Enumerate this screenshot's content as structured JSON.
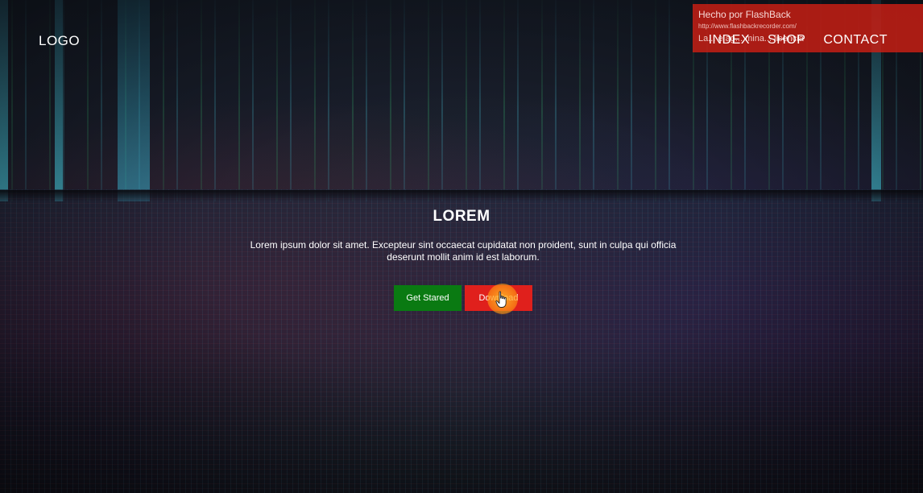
{
  "navbar": {
    "logo": "LOGO",
    "links": [
      {
        "label": "INDEX"
      },
      {
        "label": "SHOP"
      },
      {
        "label": "CONTACT"
      }
    ]
  },
  "watermark": {
    "title": "Hecho por FlashBack",
    "url": "http://www.flashbackrecorder.com/",
    "note": "La... e ag... mina... licencia"
  },
  "hero": {
    "headline": "LOREM",
    "tagline": "Lorem ipsum dolor sit amet. Excepteur sint occaecat cupidatat non proident, sunt in culpa qui officia deserunt mollit anim id est laborum.",
    "primary_button": "Get Stared",
    "secondary_button": "Download"
  },
  "colors": {
    "primary_button": "#0a7a12",
    "secondary_button": "#e0201c",
    "watermark_bg": "#cd1e14",
    "text": "#ffffff"
  },
  "icons": {
    "cursor": "hand-pointer-icon"
  }
}
